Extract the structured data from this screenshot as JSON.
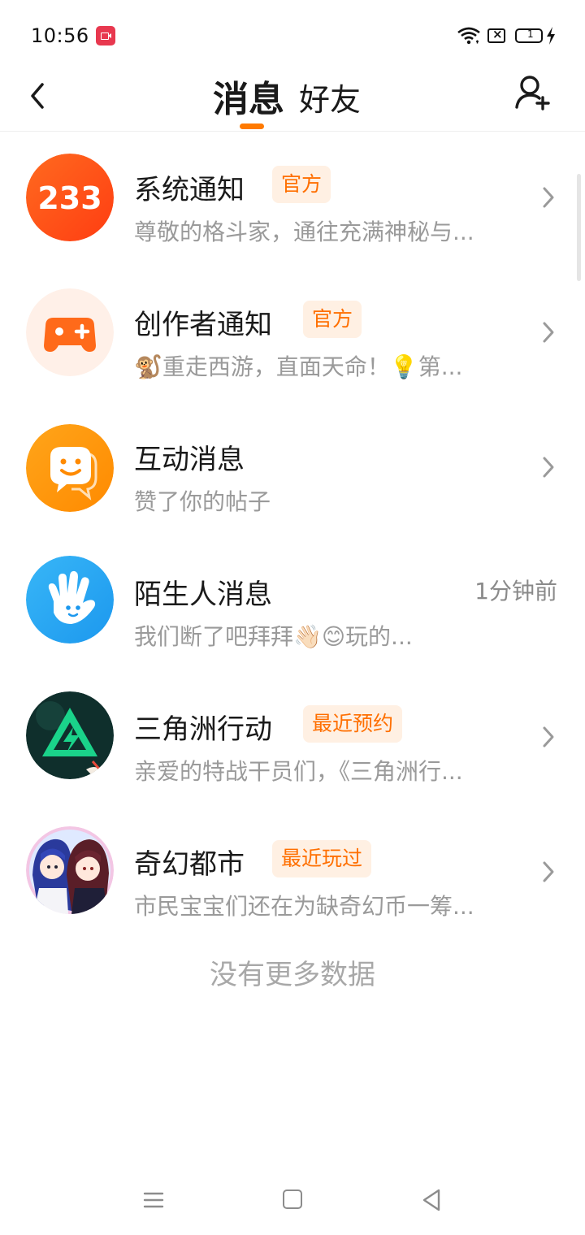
{
  "status_bar": {
    "time": "10:56",
    "battery": "1"
  },
  "header": {
    "tab_messages": "消息",
    "tab_friends": "好友",
    "accent": "#ff7a00"
  },
  "icons": {
    "back": "chevron-left-icon",
    "add_friend": "add-user-icon"
  },
  "messages": [
    {
      "title": "系统通知",
      "badge": "官方",
      "preview": "尊敬的格斗家，通往充满神秘与...",
      "avatar": "233-logo",
      "avatar_color": "#ff5a1f"
    },
    {
      "title": "创作者通知",
      "badge": "官方",
      "preview": "🐒重走西游，直面天命！💡第...",
      "avatar": "gamepad-plus",
      "avatar_color": "#ff6a1a"
    },
    {
      "title": "互动消息",
      "preview": "赞了你的帖子",
      "avatar": "chat-smile",
      "avatar_color": "#ff9a0d"
    },
    {
      "title": "陌生人消息",
      "time": "1分钟前",
      "preview": "我们断了吧拜拜👋🏻😊玩的...",
      "avatar": "hand-wave",
      "avatar_color": "#2aa9f5"
    },
    {
      "title": "三角洲行动",
      "badge": "最近预约",
      "preview": "亲爱的特战干员们，《三角洲行...",
      "avatar": "delta-force-logo",
      "avatar_color": "#1ad38a"
    },
    {
      "title": "奇幻都市",
      "badge": "最近玩过",
      "preview": "市民宝宝们还在为缺奇幻币一筹...",
      "avatar": "anime-characters",
      "avatar_color": "#3a4fa8"
    }
  ],
  "footer_text": "没有更多数据"
}
